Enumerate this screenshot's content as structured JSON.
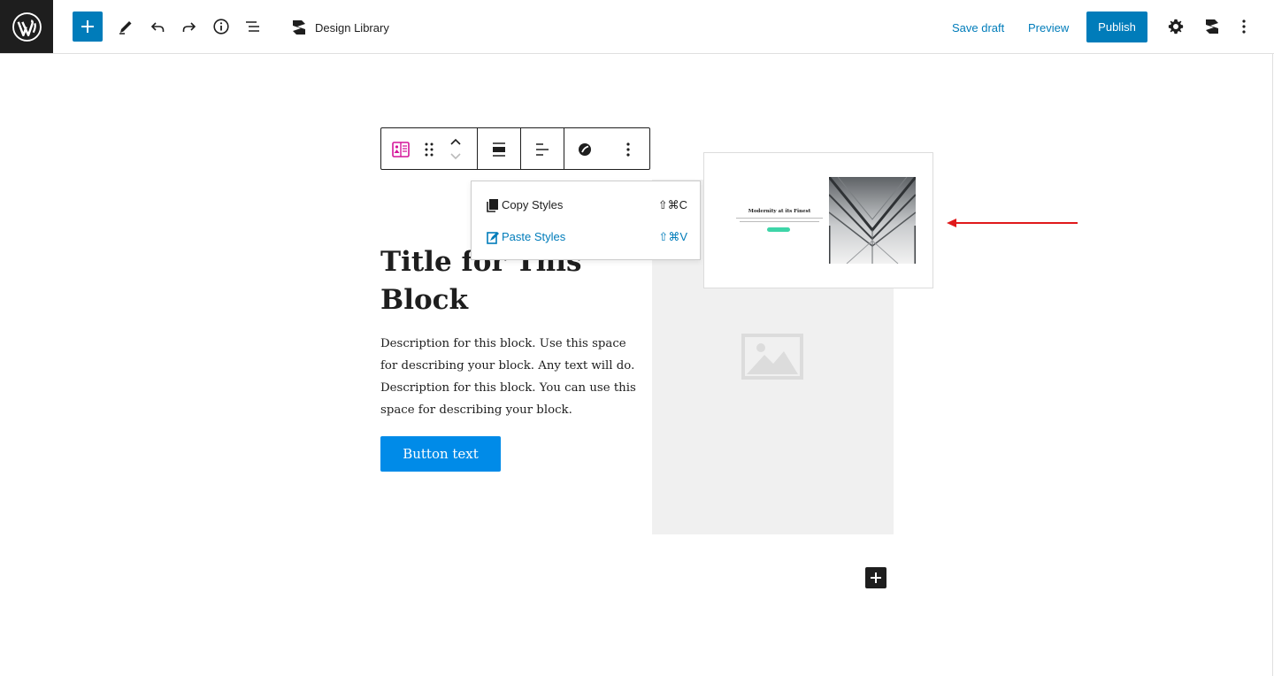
{
  "topbar": {
    "design_library_label": "Design Library",
    "save_draft_label": "Save draft",
    "preview_label": "Preview",
    "publish_label": "Publish",
    "icons": [
      "wordpress-logo",
      "plus-icon",
      "pencil-icon",
      "undo-icon",
      "redo-icon",
      "info-icon",
      "list-view-icon",
      "stackable-icon",
      "gear-icon",
      "stackable-icon",
      "more-vertical-icon"
    ]
  },
  "block_toolbar": {
    "icons": [
      "block-type-icon",
      "drag-handle-icon",
      "move-up-icon",
      "move-down-icon",
      "align-wide-icon",
      "text-align-left-icon",
      "styles-icon",
      "more-options-icon"
    ]
  },
  "styles_menu": {
    "items": [
      {
        "label": "Copy Styles",
        "shortcut": "⇧⌘C",
        "icon": "copy-icon"
      },
      {
        "label": "Paste Styles",
        "shortcut": "⇧⌘V",
        "icon": "paste-icon"
      }
    ]
  },
  "block": {
    "title": "Title for This Block",
    "description": "Description for this block. Use this space for describing your block. Any text will do. Description for this block. You can use this space for describing your block.",
    "button_label": "Button text"
  },
  "preview_card": {
    "title": "Modernity at its Finest"
  },
  "colors": {
    "accent": "#007cba",
    "dark": "#1e1e1e",
    "block_button": "#008be8",
    "preview_button": "#3ed5a8",
    "arrow": "#e0191b"
  }
}
